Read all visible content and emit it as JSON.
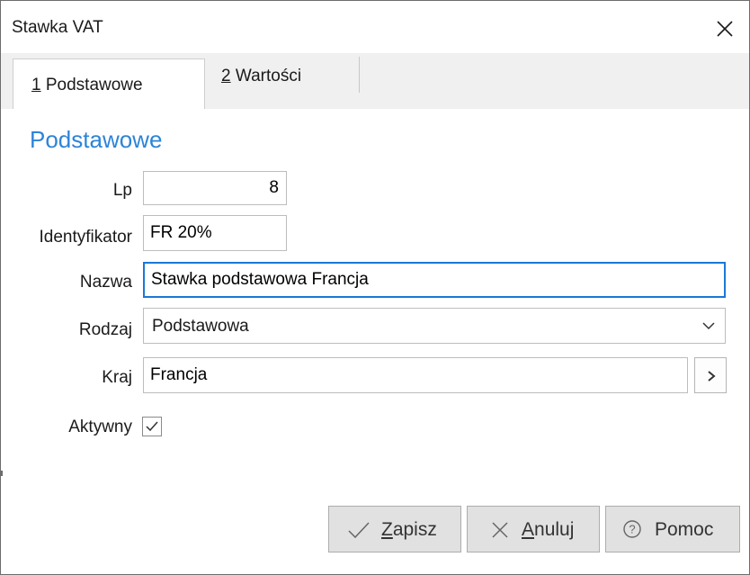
{
  "window": {
    "title": "Stawka VAT"
  },
  "tabs": [
    {
      "mnemonic": "1",
      "label": " Podstawowe",
      "active": true
    },
    {
      "mnemonic": "2",
      "label": " Wartości",
      "active": false
    }
  ],
  "section": {
    "title": "Podstawowe"
  },
  "form": {
    "lp": {
      "label": "Lp",
      "value": "8"
    },
    "identyfikator": {
      "label": "Identyfikator",
      "value": "FR 20%"
    },
    "nazwa": {
      "label": "Nazwa",
      "value": "Stawka podstawowa Francja"
    },
    "rodzaj": {
      "label": "Rodzaj",
      "value": "Podstawowa"
    },
    "kraj": {
      "label": "Kraj",
      "value": "Francja"
    },
    "aktywny": {
      "label": "Aktywny",
      "checked": true
    }
  },
  "buttons": {
    "save": {
      "mnemonic": "Z",
      "rest": "apisz",
      "icon": "checkmark-icon"
    },
    "cancel": {
      "mnemonic": "A",
      "rest": "nuluj",
      "icon": "x-icon"
    },
    "help": {
      "label": "Pomoc",
      "icon": "question-circle-icon"
    }
  },
  "colors": {
    "accent": "#2d84d8",
    "focus_border": "#1a78d6",
    "button_bg": "#e1e1e1",
    "tabstrip_bg": "#f0f0f0"
  }
}
